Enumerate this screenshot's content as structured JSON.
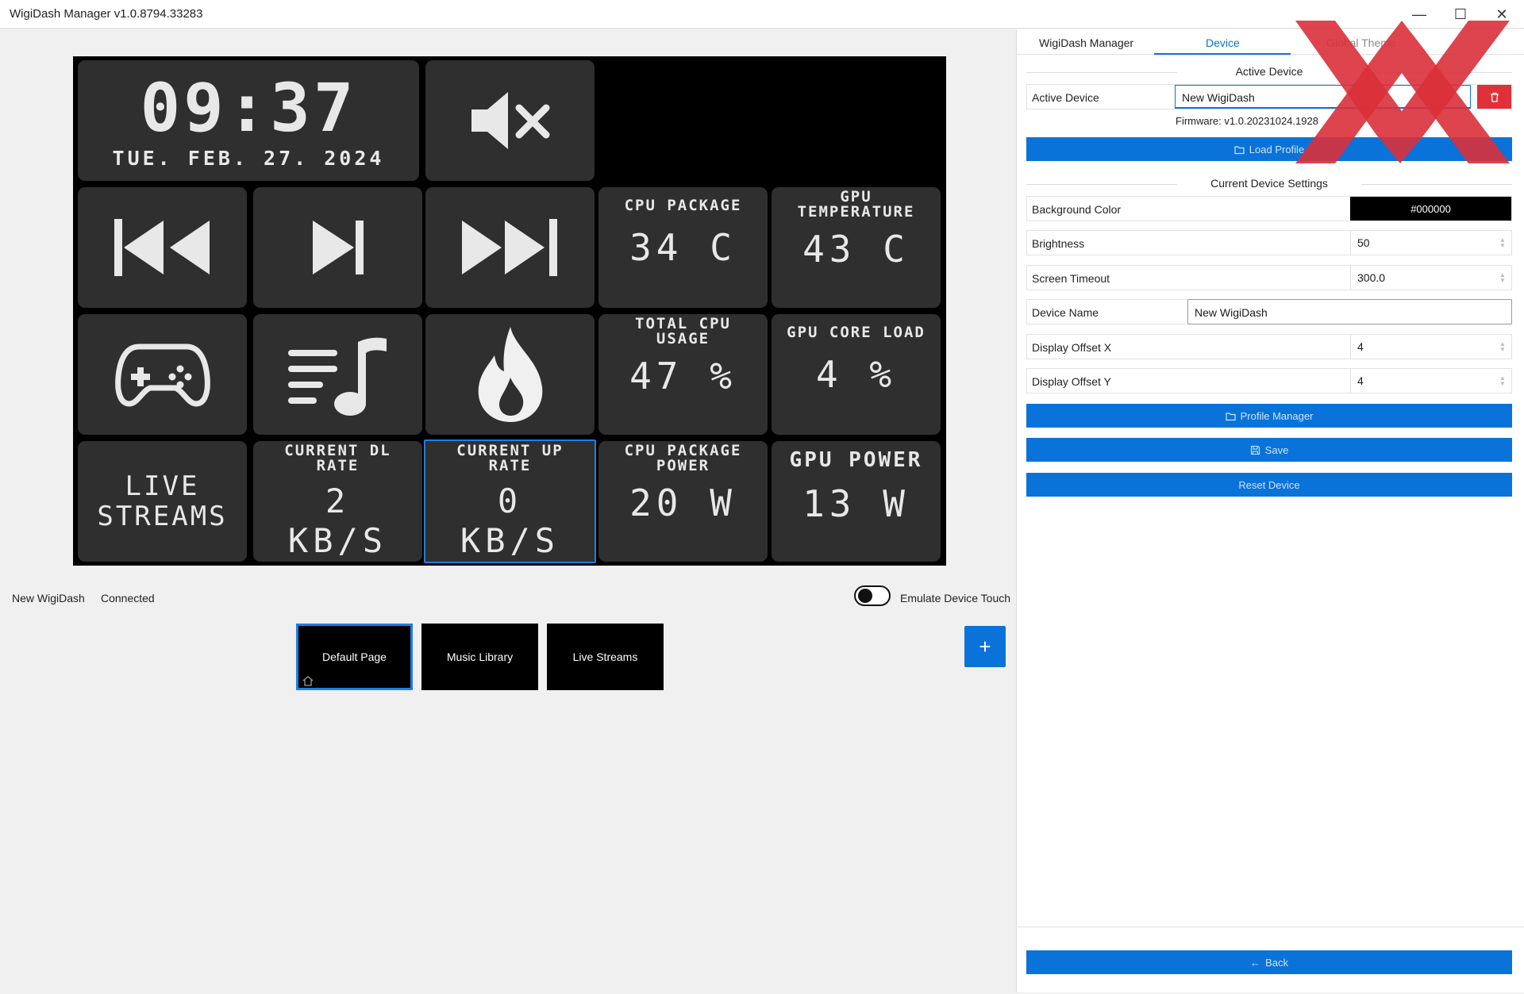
{
  "window": {
    "title": "WigiDash Manager v1.0.8794.33283",
    "min_glyph": "—",
    "max_glyph": "☐",
    "close_glyph": "✕"
  },
  "dashboard": {
    "clock": {
      "time": "09:37",
      "date": "TUE. FEB. 27. 2024"
    },
    "live_streams": {
      "line1": "LIVE",
      "line2": "STREAMS"
    },
    "cpu_package": {
      "label": "CPU PACKAGE",
      "value": "34 C"
    },
    "gpu_temperature": {
      "label_line1": "GPU",
      "label_line2": "TEMPERATURE",
      "value": "43 C"
    },
    "total_cpu_usage": {
      "label_line1": "TOTAL CPU",
      "label_line2": "USAGE",
      "value": "47 %"
    },
    "gpu_core_load": {
      "label": "GPU CORE LOAD",
      "value": "4 %"
    },
    "current_dl_rate": {
      "label_line1": "CURRENT DL",
      "label_line2": "RATE",
      "value": "2",
      "unit": "KB/S"
    },
    "current_up_rate": {
      "label_line1": "CURRENT UP",
      "label_line2": "RATE",
      "value": "0",
      "unit": "KB/S"
    },
    "cpu_package_power": {
      "label_line1": "CPU PACKAGE",
      "label_line2": "POWER",
      "value": "20 W"
    },
    "gpu_power": {
      "label": "GPU POWER",
      "value": "13 W"
    }
  },
  "status": {
    "device_name": "New WigiDash",
    "connection": "Connected",
    "emulate_touch_label": "Emulate Device Touch"
  },
  "pages": [
    {
      "label": "Default Page"
    },
    {
      "label": "Music Library"
    },
    {
      "label": "Live Streams"
    }
  ],
  "add_page_glyph": "+",
  "tabs": [
    {
      "label": "WigiDash Manager"
    },
    {
      "label": "Device"
    },
    {
      "label": "Global Theme"
    }
  ],
  "device": {
    "active_section_title": "Active Device",
    "active_device_label": "Active Device",
    "active_device_value": "New WigiDash",
    "firmware": "Firmware: v1.0.20231024.1928",
    "load_profile_label": "Load Profile",
    "settings_section_title": "Current Device Settings",
    "background_color_label": "Background Color",
    "background_color_value": "#000000",
    "brightness_label": "Brightness",
    "brightness_value": "50",
    "screen_timeout_label": "Screen Timeout",
    "screen_timeout_value": "300.0",
    "device_name_label": "Device Name",
    "device_name_value": "New WigiDash",
    "offset_x_label": "Display Offset X",
    "offset_x_value": "4",
    "offset_y_label": "Display Offset Y",
    "offset_y_value": "4",
    "profile_manager_label": "Profile Manager",
    "save_label": "Save",
    "reset_device_label": "Reset Device",
    "back_label": "Back",
    "back_arrow": "←"
  },
  "colors": {
    "accent": "#0a73d9",
    "tile": "#2f2f2f",
    "danger": "#e0313a",
    "watermark": "#d9303a"
  },
  "icons": [
    "mute-icon",
    "previous-track-icon",
    "play-pause-icon",
    "next-track-icon",
    "gamepad-icon",
    "playlist-icon",
    "flame-icon",
    "trash-icon",
    "folder-icon",
    "save-icon",
    "home-icon"
  ]
}
